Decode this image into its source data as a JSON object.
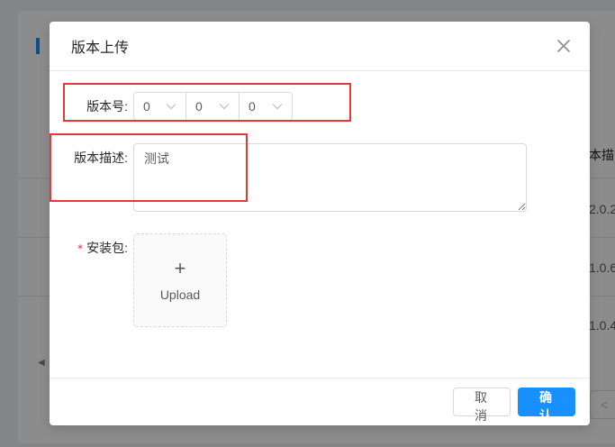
{
  "background": {
    "column_header": "本描",
    "cells": [
      "2.0.2",
      "1.0.6",
      "1.0.4"
    ],
    "pager_prev": "<"
  },
  "modal": {
    "title": "版本上传",
    "close_icon": "close-icon",
    "version": {
      "label": "版本号:",
      "parts": [
        "0",
        "0",
        "0"
      ]
    },
    "description": {
      "label": "版本描述:",
      "value": "测试"
    },
    "package": {
      "label": "安装包:",
      "required_mark": "*",
      "upload_plus": "+",
      "upload_text": "Upload"
    },
    "footer": {
      "cancel_label": "取 消",
      "confirm_label": "确 认"
    }
  },
  "colors": {
    "primary": "#1890ff",
    "annotation": "#e53935",
    "required": "#f5222d"
  }
}
